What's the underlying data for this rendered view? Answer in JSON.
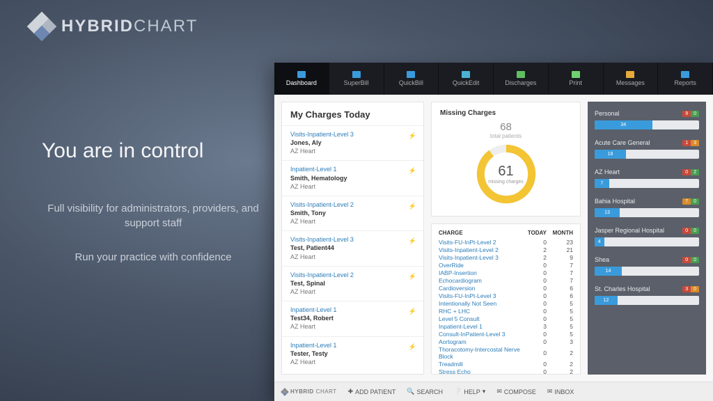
{
  "brand": {
    "bold": "HYBRID",
    "light": "CHART"
  },
  "marketing": {
    "headline": "You are in control",
    "line1": "Full visibility for administrators, providers, and support staff",
    "line2": "Run your practice with confidence"
  },
  "topnav": [
    {
      "label": "Dashboard",
      "color": "#3a9bdc"
    },
    {
      "label": "SuperBill",
      "color": "#3a9bdc"
    },
    {
      "label": "QuickBill",
      "color": "#3a9bdc"
    },
    {
      "label": "QuickEdit",
      "color": "#4bb1d4"
    },
    {
      "label": "Discharges",
      "color": "#5fbf5f"
    },
    {
      "label": "Print",
      "color": "#6fd06f"
    },
    {
      "label": "Messages",
      "color": "#e6a93a"
    },
    {
      "label": "Reports",
      "color": "#3a9bdc"
    }
  ],
  "charges_today": {
    "title": "My Charges Today",
    "items": [
      {
        "type": "Visits-Inpatient-Level 3",
        "name": "Jones, Aly",
        "facility": "AZ Heart"
      },
      {
        "type": "Inpatient-Level 1",
        "name": "Smith, Hematology",
        "facility": "AZ Heart"
      },
      {
        "type": "Visits-Inpatient-Level 2",
        "name": "Smith, Tony",
        "facility": "AZ Heart"
      },
      {
        "type": "Visits-Inpatient-Level 3",
        "name": "Test, Patient44",
        "facility": "AZ Heart"
      },
      {
        "type": "Visits-Inpatient-Level 2",
        "name": "Test, Spinal",
        "facility": "AZ Heart"
      },
      {
        "type": "Inpatient-Level 1",
        "name": "Test34, Robert",
        "facility": "AZ Heart"
      },
      {
        "type": "Inpatient-Level 1",
        "name": "Tester, Testy",
        "facility": "AZ Heart"
      }
    ]
  },
  "missing": {
    "title": "Missing Charges",
    "total_patients": "68",
    "total_patients_label": "total patients",
    "missing": "61",
    "missing_label": "missing charges",
    "pct": 90
  },
  "charge_table": {
    "headers": {
      "c1": "CHARGE",
      "c2": "TODAY",
      "c3": "MONTH"
    },
    "rows": [
      {
        "c": "Visits-FU-InPt-Level 2",
        "t": "0",
        "m": "23"
      },
      {
        "c": "Visits-Inpatient-Level 2",
        "t": "2",
        "m": "21"
      },
      {
        "c": "Visits-Inpatient-Level 3",
        "t": "2",
        "m": "9"
      },
      {
        "c": "OverRide",
        "t": "0",
        "m": "7"
      },
      {
        "c": "IABP-Insertion",
        "t": "0",
        "m": "7"
      },
      {
        "c": "Echocardiogram",
        "t": "0",
        "m": "7"
      },
      {
        "c": "Cardioversion",
        "t": "0",
        "m": "6"
      },
      {
        "c": "Visits-FU-InPt-Level 3",
        "t": "0",
        "m": "6"
      },
      {
        "c": "Intentionally Not Seen",
        "t": "0",
        "m": "5"
      },
      {
        "c": "RHC + LHC",
        "t": "0",
        "m": "5"
      },
      {
        "c": "Level 5 Consult",
        "t": "0",
        "m": "5"
      },
      {
        "c": "Inpatient-Level 1",
        "t": "3",
        "m": "5"
      },
      {
        "c": "Consult-InPatient-Level 3",
        "t": "0",
        "m": "5"
      },
      {
        "c": "Aortogram",
        "t": "0",
        "m": "3"
      },
      {
        "c": "Thoracotomy-Intercostal Nerve Block",
        "t": "0",
        "m": "2"
      },
      {
        "c": "Treadmill",
        "t": "0",
        "m": "2"
      },
      {
        "c": "Stress Echo",
        "t": "0",
        "m": "2"
      }
    ]
  },
  "facilities": [
    {
      "name": "Personal",
      "val": "34",
      "pct": 55,
      "b1": "9",
      "b2": "0",
      "b1c": "r",
      "b2c": "g"
    },
    {
      "name": "Acute Care General",
      "val": "18",
      "pct": 30,
      "b1": "1",
      "b2": "3",
      "b1c": "r",
      "b2c": "o"
    },
    {
      "name": "AZ Heart",
      "val": "7",
      "pct": 14,
      "b1": "0",
      "b2": "2",
      "b1c": "r",
      "b2c": "g"
    },
    {
      "name": "Bahia Hospital",
      "val": "13",
      "pct": 24,
      "b1": "7",
      "b2": "0",
      "b1c": "o",
      "b2c": "g"
    },
    {
      "name": "Jasper Regional Hospital",
      "val": "4",
      "pct": 9,
      "b1": "0",
      "b2": "0",
      "b1c": "r",
      "b2c": "g"
    },
    {
      "name": "Shea",
      "val": "14",
      "pct": 26,
      "b1": "0",
      "b2": "0",
      "b1c": "r",
      "b2c": "g"
    },
    {
      "name": "St. Charles Hospital",
      "val": "12",
      "pct": 22,
      "b1": "3",
      "b2": "0",
      "b1c": "r",
      "b2c": "o"
    }
  ],
  "bottom": {
    "add_patient": "ADD PATIENT",
    "search": "SEARCH",
    "help": "HELP",
    "compose": "COMPOSE",
    "inbox": "INBOX"
  }
}
